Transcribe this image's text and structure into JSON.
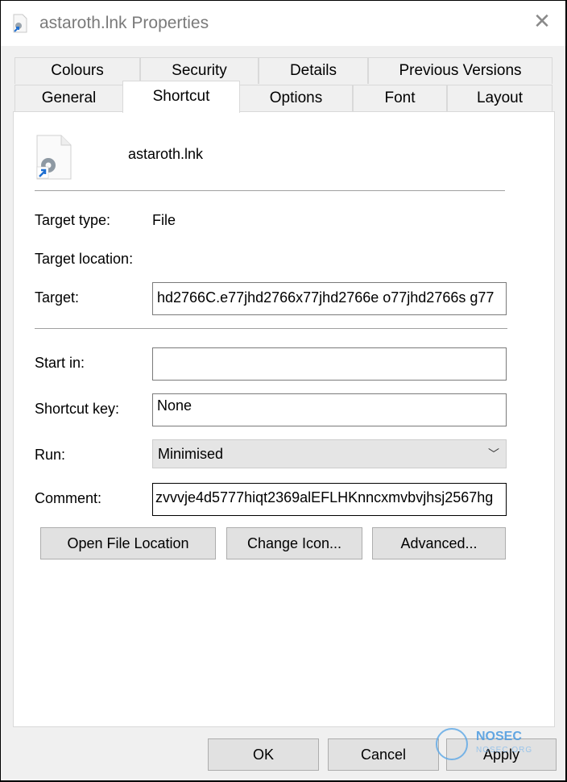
{
  "window": {
    "title": "astaroth.lnk Properties"
  },
  "tabs_row1": [
    "Colours",
    "Security",
    "Details",
    "Previous Versions"
  ],
  "tabs_row2": [
    "General",
    "Shortcut",
    "Options",
    "Font",
    "Layout"
  ],
  "active_tab": "Shortcut",
  "shortcut": {
    "filename": "astaroth.lnk",
    "target_type_label": "Target type:",
    "target_type_value": "File",
    "target_location_label": "Target location:",
    "target_label": "Target:",
    "target_value": "hd2766C.e77jhd2766x77jhd2766e o77jhd2766s g77",
    "start_in_label": "Start in:",
    "start_in_value": "",
    "shortcut_key_label": "Shortcut key:",
    "shortcut_key_value": "None",
    "run_label": "Run:",
    "run_value": "Minimised",
    "comment_label": "Comment:",
    "comment_value": "zvvvje4d5777hiqt2369alEFLHKnncxmvbvjhsj2567hg"
  },
  "buttons": {
    "open_file_location": "Open File Location",
    "change_icon": "Change Icon...",
    "advanced": "Advanced..."
  },
  "dialog_buttons": {
    "ok": "OK",
    "cancel": "Cancel",
    "apply": "Apply"
  },
  "watermark": {
    "brand": "NOSEC",
    "sub": "NOSEC.ORG"
  }
}
